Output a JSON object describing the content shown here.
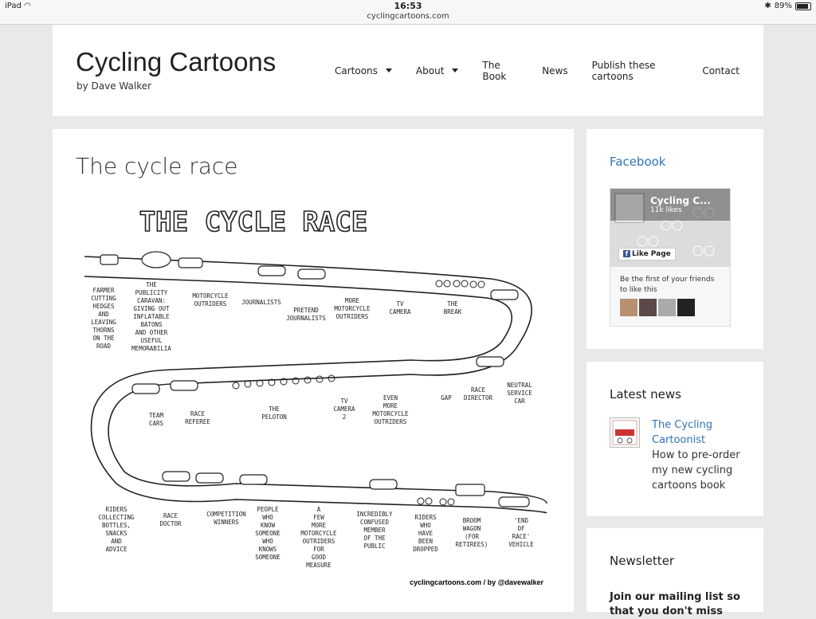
{
  "status": {
    "device": "iPad",
    "time": "16:53",
    "url": "cyclingcartoons.com",
    "battery": "89%",
    "battery_level": 0.89
  },
  "site": {
    "title": "Cycling Cartoons",
    "subtitle": "by Dave Walker"
  },
  "nav": [
    {
      "label": "Cartoons",
      "has_dropdown": true
    },
    {
      "label": "About",
      "has_dropdown": true
    },
    {
      "label": "The Book",
      "has_dropdown": false
    },
    {
      "label": "News",
      "has_dropdown": false
    },
    {
      "label": "Publish these cartoons",
      "has_dropdown": false
    },
    {
      "label": "Contact",
      "has_dropdown": false
    }
  ],
  "post": {
    "title": "The cycle race",
    "cartoon": {
      "heading": "THE CYCLE RACE",
      "credit": "cyclingcartoons.com / by @davewalker",
      "labels": {
        "farmer": [
          "FARMER",
          "CUTTING",
          "HEDGES",
          "AND",
          "LEAVING",
          "THORNS",
          "ON THE",
          "ROAD"
        ],
        "caravan": [
          "THE",
          "PUBLICITY",
          "CARAVAN:",
          "GIVING OUT",
          "INFLATABLE",
          "BATONS",
          "AND OTHER",
          "USEFUL",
          "MEMORABILIA"
        ],
        "moto": [
          "MOTORCYCLE",
          "OUTRIDERS"
        ],
        "journalists": [
          "JOURNALISTS"
        ],
        "pretend": [
          "PRETEND",
          "JOURNALISTS"
        ],
        "more_moto": [
          "MORE",
          "MOTORCYCLE",
          "OUTRIDERS"
        ],
        "tv": [
          "TV",
          "CAMERA"
        ],
        "break": [
          "THE",
          "BREAK"
        ],
        "team": [
          "TEAM",
          "CARS"
        ],
        "referee": [
          "RACE",
          "REFEREE"
        ],
        "peloton": [
          "THE",
          "PELOTON"
        ],
        "tv2": [
          "TV",
          "CAMERA",
          "2"
        ],
        "even_more": [
          "EVEN",
          "MORE",
          "MOTORCYCLE",
          "OUTRIDERS"
        ],
        "gap": [
          "GAP"
        ],
        "director": [
          "RACE",
          "DIRECTOR"
        ],
        "neutral": [
          "NEUTRAL",
          "SERVICE",
          "CAR"
        ],
        "riders_bottles": [
          "RIDERS",
          "COLLECTING",
          "BOTTLES,",
          "SNACKS",
          "AND",
          "ADVICE"
        ],
        "doctor": [
          "RACE",
          "DOCTOR"
        ],
        "winners": [
          "COMPETITION",
          "WINNERS"
        ],
        "people": [
          "PEOPLE",
          "WHO",
          "KNOW",
          "SOMEONE",
          "WHO",
          "KNOWS",
          "SOMEONE"
        ],
        "few_more": [
          "A",
          "FEW",
          "MORE",
          "MOTORCYCLE",
          "OUTRIDERS",
          "FOR",
          "GOOD",
          "MEASURE"
        ],
        "confused": [
          "INCREDIBLY",
          "CONFUSED",
          "MEMBER",
          "OF THE",
          "PUBLIC"
        ],
        "dropped": [
          "RIDERS",
          "WHO",
          "HAVE",
          "BEEN",
          "DROPPED"
        ],
        "broom": [
          "BROOM",
          "WAGON",
          "(FOR",
          "RETIREES)"
        ],
        "end": [
          "'END",
          "OF",
          "RACE'",
          "VEHICLE"
        ]
      }
    }
  },
  "facebook": {
    "title": "Facebook",
    "page_name": "Cycling C...",
    "likes": "11k likes",
    "like_button": "Like Page",
    "friends_text": "Be the first of your friends to like this"
  },
  "latest_news": {
    "title": "Latest news",
    "link": "The Cycling Cartoonist",
    "description": "How to pre-order my new cycling cartoons book"
  },
  "newsletter": {
    "title": "Newsletter",
    "text": "Join our mailing list so that you don't miss"
  },
  "colors": {
    "link": "#2e74b7",
    "fb_blue": "#3b5998",
    "page_bg": "#e9e9e9"
  }
}
